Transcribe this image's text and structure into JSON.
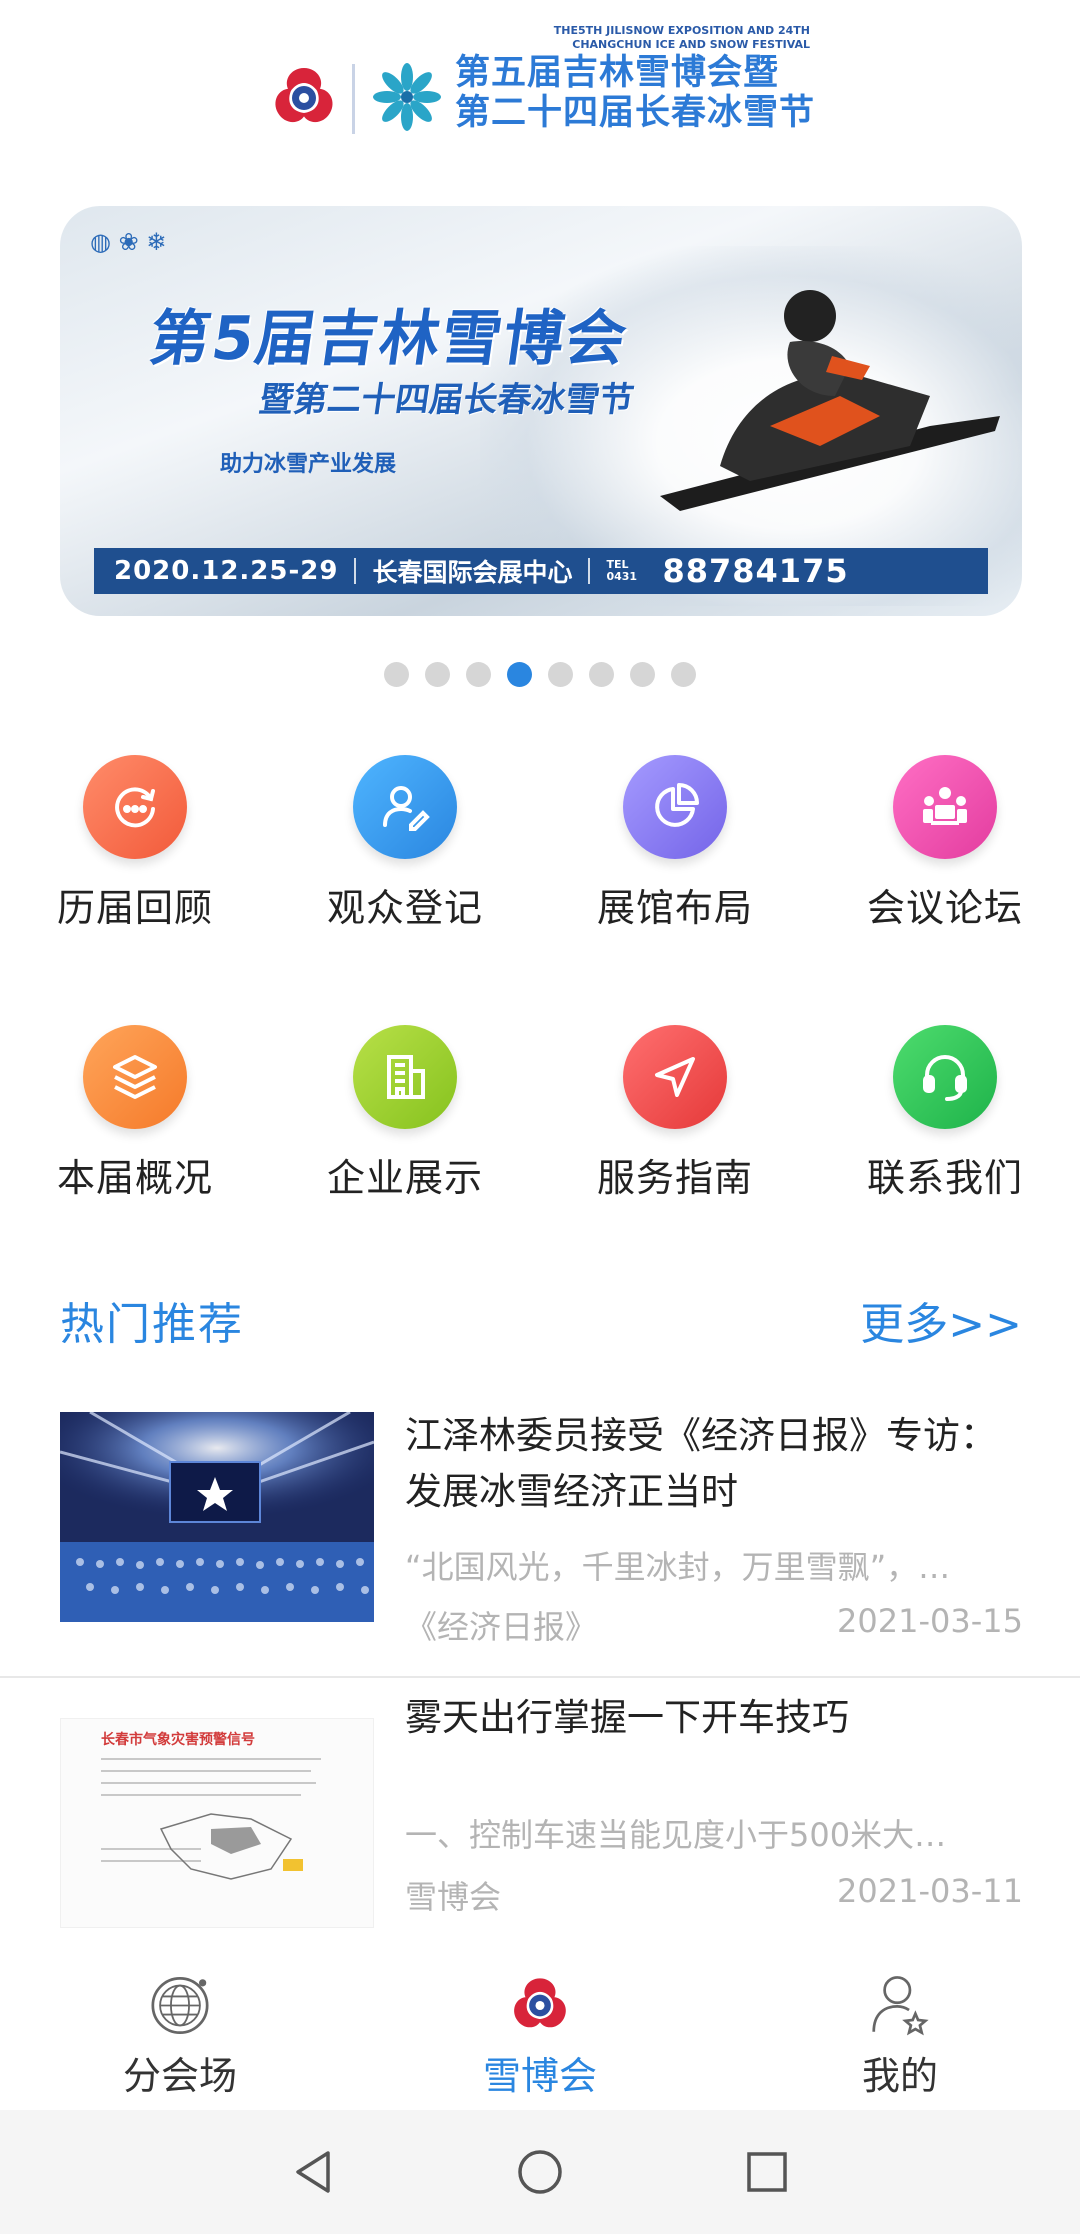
{
  "header": {
    "subtitle_en_1": "THE5TH JILISNOW EXPOSITION AND 24TH",
    "subtitle_en_2": "CHANGCHUN ICE AND SNOW FESTIVAL",
    "title_line_1": "第五届吉林雪博会暨",
    "title_line_2": "第二十四届长春冰雪节"
  },
  "banner": {
    "headline": "第5届吉林雪博会",
    "sub_headline": "暨第二十四届长春冰雪节",
    "slogan": "助力冰雪产业发展",
    "date": "2020.12.25-29",
    "venue": "长春国际会展中心",
    "tel_label": "TEL 0431",
    "phone": "88784175",
    "active_slide": 4,
    "slide_count": 8
  },
  "grid": [
    {
      "label": "历届回顾",
      "icon": "history-icon",
      "color": "#f25a3a"
    },
    {
      "label": "观众登记",
      "icon": "user-register-icon",
      "color": "#2a86e0"
    },
    {
      "label": "展馆布局",
      "icon": "pie-chart-icon",
      "color": "#7464e8"
    },
    {
      "label": "会议论坛",
      "icon": "meeting-icon",
      "color": "#e33c9f"
    },
    {
      "label": "本届概况",
      "icon": "layers-icon",
      "color": "#f57a2a"
    },
    {
      "label": "企业展示",
      "icon": "building-icon",
      "color": "#86c21e"
    },
    {
      "label": "服务指南",
      "icon": "navigation-icon",
      "color": "#e53939"
    },
    {
      "label": "联系我们",
      "icon": "headset-icon",
      "color": "#1eb34a"
    }
  ],
  "section": {
    "title": "热门推荐",
    "more": "更多>>"
  },
  "news": [
    {
      "headline": "江泽林委员接受《经济日报》专访：发展冰雪经济正当时",
      "summary": "“北国风光，千里冰封，万里雪飘”，…",
      "source": "《经济日报》",
      "date": "2021-03-15"
    },
    {
      "headline": "雾天出行掌握一下开车技巧",
      "summary": "一、控制车速当能见度小于500米大…",
      "source": "雪博会",
      "date": "2021-03-11",
      "thumb_title": "长春市气象灾害预警信号"
    }
  ],
  "tabbar": [
    {
      "label": "分会场",
      "icon": "globe-icon",
      "active": false
    },
    {
      "label": "雪博会",
      "icon": "snow-expo-logo-icon",
      "active": true
    },
    {
      "label": "我的",
      "icon": "profile-icon",
      "active": false
    }
  ],
  "colors": {
    "accent": "#2a86e0"
  }
}
